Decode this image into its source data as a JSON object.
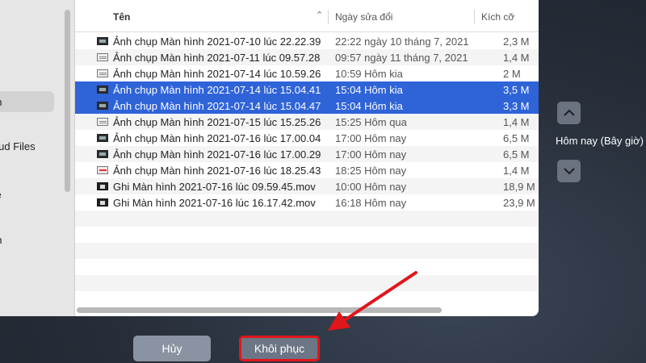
{
  "sidebar": {
    "items": [
      {
        "label": "ển",
        "selected": true
      },
      {
        "label": "loud Files",
        "selected": false
      },
      {
        "label": "ve",
        "selected": false
      },
      {
        "label": "ển",
        "selected": false
      }
    ]
  },
  "columns": {
    "name": "Tên",
    "date": "Ngày sửa đổi",
    "size": "Kích cỡ",
    "sort_indicator": "^"
  },
  "files": [
    {
      "name": "Ảnh chụp Màn hình 2021-07-10 lúc 22.22.39",
      "date": "22:22 ngày 10 tháng 7, 2021",
      "size": "2,3 M",
      "icon": "screenshot-dark-thumb",
      "selected": false
    },
    {
      "name": "Ảnh chụp Màn hình 2021-07-11 lúc 09.57.28",
      "date": "09:57 ngày 11 tháng 7, 2021",
      "size": "1,4 M",
      "icon": "screenshot-light-thumb",
      "selected": false
    },
    {
      "name": "Ảnh chụp Màn hình 2021-07-14 lúc 10.59.26",
      "date": "10:59 Hôm kia",
      "size": "2 M",
      "icon": "screenshot-light-thumb",
      "selected": false
    },
    {
      "name": "Ảnh chụp Màn hình 2021-07-14 lúc 15.04.41",
      "date": "15:04 Hôm kia",
      "size": "3,5 M",
      "icon": "screenshot-dark-thumb",
      "selected": true
    },
    {
      "name": "Ảnh chụp Màn hình 2021-07-14 lúc 15.04.47",
      "date": "15:04 Hôm kia",
      "size": "3,3 M",
      "icon": "screenshot-dark-thumb",
      "selected": true
    },
    {
      "name": "Ảnh chụp Màn hình 2021-07-15 lúc 15.25.26",
      "date": "15:25 Hôm qua",
      "size": "1,4 M",
      "icon": "screenshot-light-thumb",
      "selected": false
    },
    {
      "name": "Ảnh chụp Màn hình 2021-07-16 lúc 17.00.04",
      "date": "17:00 Hôm nay",
      "size": "6,5 M",
      "icon": "screenshot-dark-thumb",
      "selected": false
    },
    {
      "name": "Ảnh chụp Màn hình 2021-07-16 lúc 17.00.29",
      "date": "17:00 Hôm nay",
      "size": "6,5 M",
      "icon": "screenshot-dark-thumb",
      "selected": false
    },
    {
      "name": "Ảnh chụp Màn hình 2021-07-16 lúc 18.25.43",
      "date": "18:25 Hôm nay",
      "size": "1,4 M",
      "icon": "screenshot-red-thumb",
      "selected": false
    },
    {
      "name": "Ghi Màn hình 2021-07-16 lúc 09.59.45.mov",
      "date": "10:00 Hôm nay",
      "size": "18,9 M",
      "icon": "movie-thumb",
      "selected": false
    },
    {
      "name": "Ghi Màn hình 2021-07-16 lúc 16.17.42.mov",
      "date": "16:18 Hôm nay",
      "size": "23,9 M",
      "icon": "movie-thumb",
      "selected": false
    }
  ],
  "timeline": {
    "label": "Hôm nay (Bây giờ)",
    "up_icon": "chevron-up-icon",
    "down_icon": "chevron-down-icon"
  },
  "buttons": {
    "cancel": "Hủy",
    "restore": "Khôi phục"
  },
  "colors": {
    "selection": "#2f63d8",
    "highlight_border": "#e0161b",
    "arrow": "#e0161b"
  }
}
